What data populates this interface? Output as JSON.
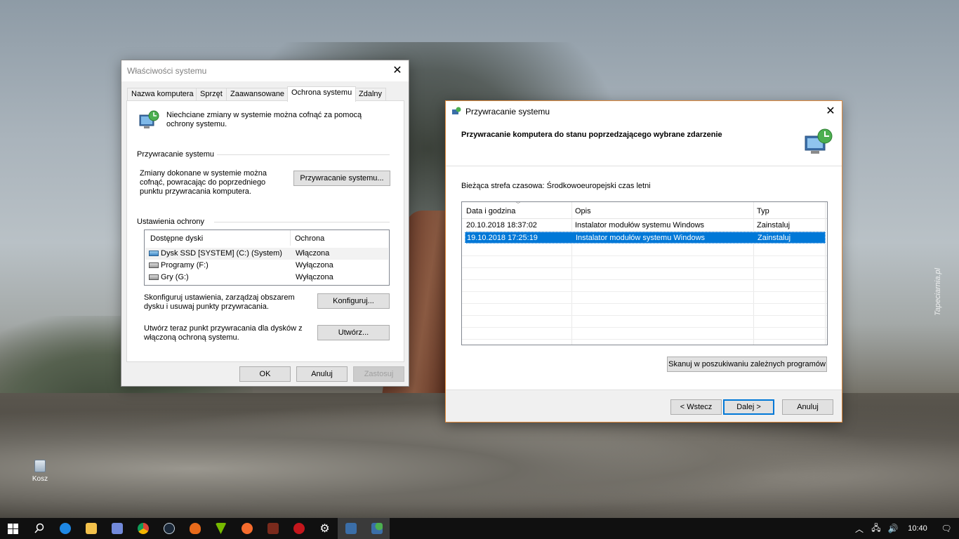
{
  "desktop": {
    "recycle_bin_label": "Kosz",
    "watermark": "Tapeciarnia.pl"
  },
  "system_properties": {
    "title": "Właściwości systemu",
    "tabs": [
      {
        "label": "Nazwa komputera"
      },
      {
        "label": "Sprzęt"
      },
      {
        "label": "Zaawansowane"
      },
      {
        "label": "Ochrona systemu"
      },
      {
        "label": "Zdalny"
      }
    ],
    "active_tab": "Ochrona systemu",
    "intro_text": "Niechciane zmiany w systemie można cofnąć za pomocą ochrony systemu.",
    "restore_group": {
      "title": "Przywracanie systemu",
      "description": "Zmiany dokonane w systemie można cofnąć, powracając do poprzedniego punktu przywracania komputera.",
      "button": "Przywracanie systemu..."
    },
    "protection_group": {
      "title": "Ustawienia ochrony",
      "columns": [
        "Dostępne dyski",
        "Ochrona"
      ],
      "drives": [
        {
          "name": "Dysk SSD [SYSTEM] (C:) (System)",
          "state": "Włączona",
          "icon": "system-drive-icon"
        },
        {
          "name": "Programy (F:)",
          "state": "Wyłączona",
          "icon": "drive-icon"
        },
        {
          "name": "Gry (G:)",
          "state": "Wyłączona",
          "icon": "drive-icon"
        }
      ]
    },
    "configure_text": "Skonfiguruj ustawienia, zarządzaj obszarem dysku i usuwaj punkty przywracania.",
    "configure_button": "Konfiguruj...",
    "create_text": "Utwórz teraz punkt przywracania dla dysków z włączoną ochroną systemu.",
    "create_button": "Utwórz...",
    "ok_button": "OK",
    "cancel_button": "Anuluj",
    "apply_button": "Zastosuj"
  },
  "system_restore": {
    "title": "Przywracanie systemu",
    "heading": "Przywracanie komputera do stanu poprzedzającego wybrane zdarzenie",
    "timezone_text": "Bieżąca strefa czasowa: Środkowoeuropejski czas letni",
    "columns": [
      "Data i godzina",
      "Opis",
      "Typ"
    ],
    "rows": [
      {
        "date": "20.10.2018 18:37:02",
        "description": "Instalator modułów systemu Windows",
        "type": "Zainstaluj",
        "selected": false
      },
      {
        "date": "19.10.2018 17:25:19",
        "description": "Instalator modułów systemu Windows",
        "type": "Zainstaluj",
        "selected": true
      }
    ],
    "scan_button": "Skanuj w poszukiwaniu zależnych programów",
    "back_button": "< Wstecz",
    "next_button": "Dalej >",
    "cancel_button": "Anuluj"
  },
  "taskbar": {
    "apps": [
      {
        "icon": "start-icon"
      },
      {
        "icon": "search-icon"
      },
      {
        "icon": "edge-icon"
      },
      {
        "icon": "file-explorer-icon"
      },
      {
        "icon": "discord-icon"
      },
      {
        "icon": "chrome-icon"
      },
      {
        "icon": "steam-icon"
      },
      {
        "icon": "microphone-app-icon"
      },
      {
        "icon": "nvidia-icon"
      },
      {
        "icon": "origin-icon"
      },
      {
        "icon": "game-icon"
      },
      {
        "icon": "gamer-app-icon"
      },
      {
        "icon": "settings-icon"
      },
      {
        "icon": "system-properties-icon"
      },
      {
        "icon": "system-restore-icon"
      }
    ],
    "clock": "10:40",
    "colors": {
      "accent": "#0078d7",
      "taskbar": "#101010"
    }
  }
}
